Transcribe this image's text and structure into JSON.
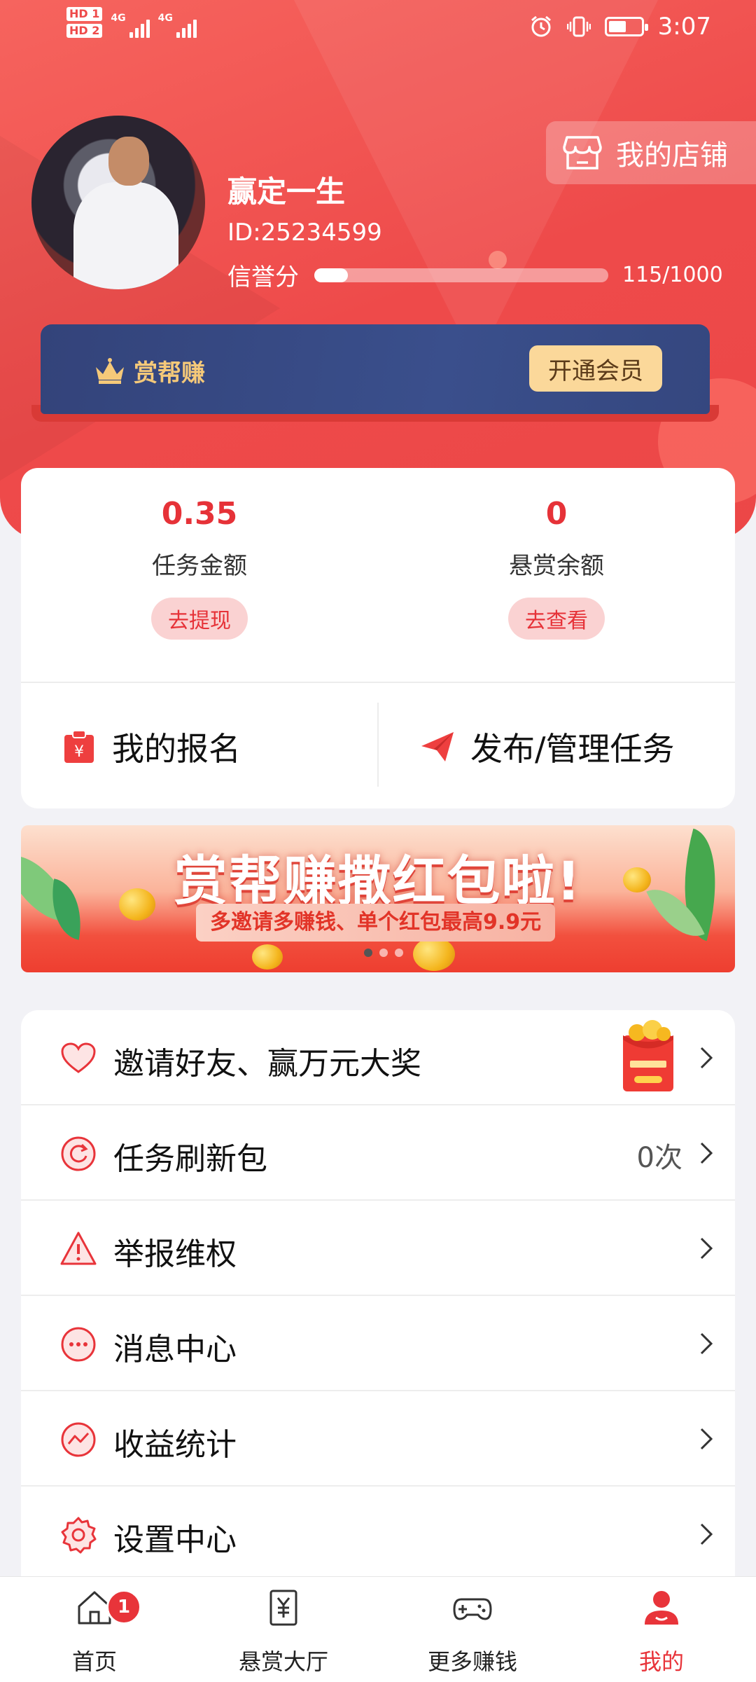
{
  "status_bar": {
    "hd1": "HD 1",
    "hd2": "HD 2",
    "net1": "4G",
    "net2": "4G",
    "time": "3:07",
    "battery_level": 0.6
  },
  "profile": {
    "username": "赢定一生",
    "user_id": "ID:25234599",
    "credit_label": "信誉分",
    "credit_value": "115/1000",
    "credit_fraction": 0.115,
    "shop_button": "我的店铺"
  },
  "vip": {
    "title": "赏帮赚",
    "button": "开通会员"
  },
  "wallet": {
    "task_amount": {
      "value": "0.35",
      "label": "任务金额",
      "button": "去提现"
    },
    "reward_balance": {
      "value": "0",
      "label": "悬赏余额",
      "button": "去查看"
    },
    "actions": [
      {
        "label": "我的报名",
        "icon": "clipboard-icon"
      },
      {
        "label": "发布/管理任务",
        "icon": "paper-plane-icon"
      }
    ]
  },
  "promo": {
    "title": "赏帮赚撒红包啦!",
    "subtitle": "多邀请多赚钱、单个红包最高9.9元"
  },
  "menu": [
    {
      "label": "邀请好友、赢万元大奖",
      "value": "",
      "icon": "heart-icon"
    },
    {
      "label": "任务刷新包",
      "value": "0次",
      "icon": "refresh-icon"
    },
    {
      "label": "举报维权",
      "value": "",
      "icon": "warning-icon"
    },
    {
      "label": "消息中心",
      "value": "",
      "icon": "chat-icon"
    },
    {
      "label": "收益统计",
      "value": "",
      "icon": "chart-icon"
    },
    {
      "label": "设置中心",
      "value": "",
      "icon": "gear-icon"
    }
  ],
  "tabs": [
    {
      "label": "首页",
      "icon": "home-icon",
      "badge": "1",
      "active": false
    },
    {
      "label": "悬赏大厅",
      "icon": "reward-hall-icon",
      "active": false
    },
    {
      "label": "更多赚钱",
      "icon": "gamepad-icon",
      "active": false
    },
    {
      "label": "我的",
      "icon": "user-icon",
      "active": true
    }
  ],
  "colors": {
    "brand_red": "#ee4a4a",
    "accent_red": "#e63238",
    "vip_navy": "#3a4f8c",
    "vip_gold": "#f5c979"
  }
}
